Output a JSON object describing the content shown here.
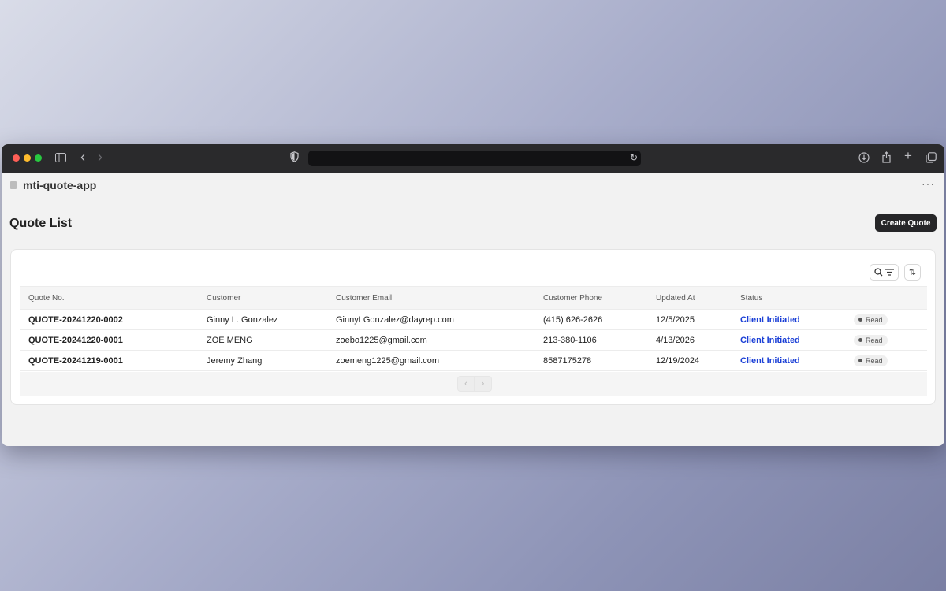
{
  "app": {
    "name": "mti-quote-app"
  },
  "page": {
    "title": "Quote List",
    "create_label": "Create Quote"
  },
  "table": {
    "columns": [
      "Quote No.",
      "Customer",
      "Customer Email",
      "Customer Phone",
      "Updated At",
      "Status",
      ""
    ],
    "rows": [
      {
        "quote_no": "QUOTE-20241220-0002",
        "customer": "Ginny L. Gonzalez",
        "email": "GinnyLGonzalez@dayrep.com",
        "phone": "(415) 626-2626",
        "updated": "12/5/2025",
        "status": "Client Initiated",
        "read": "Read"
      },
      {
        "quote_no": "QUOTE-20241220-0001",
        "customer": "ZOE MENG",
        "email": "zoebo1225@gmail.com",
        "phone": "213-380-1106",
        "updated": "4/13/2026",
        "status": "Client Initiated",
        "read": "Read"
      },
      {
        "quote_no": "QUOTE-20241219-0001",
        "customer": "Jeremy Zhang",
        "email": "zoemeng1225@gmail.com",
        "phone": "8587175278",
        "updated": "12/19/2024",
        "status": "Client Initiated",
        "read": "Read"
      }
    ]
  },
  "pager": {
    "prev": "‹",
    "next": "›"
  },
  "icons": {
    "more": "···",
    "back": "‹",
    "forward": "›",
    "reload": "↻",
    "plus": "+",
    "sort": "⇅"
  },
  "colors": {
    "status": "#1a3fd6",
    "primary_button": "#262628"
  }
}
